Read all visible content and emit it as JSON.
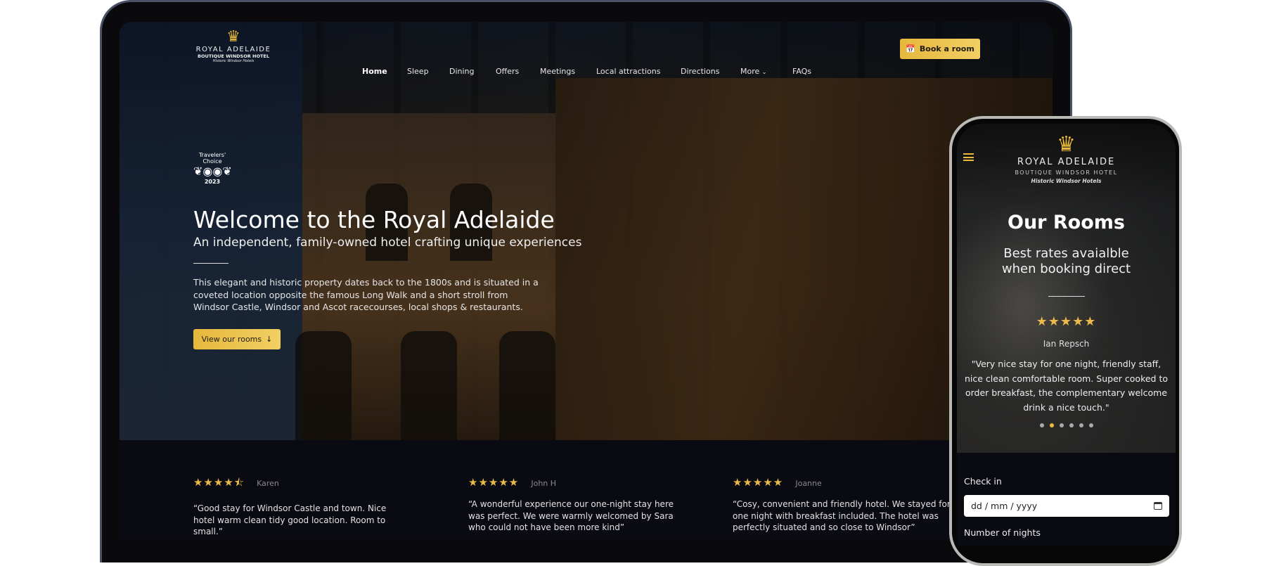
{
  "brand": {
    "name": "ROYAL ADELAIDE",
    "tagline": "BOUTIQUE WINDSOR HOTEL",
    "group": "Historic Windsor Hotels"
  },
  "nav": {
    "items": [
      "Home",
      "Sleep",
      "Dining",
      "Offers",
      "Meetings",
      "Local attractions",
      "Directions",
      "More",
      "FAQs"
    ],
    "book_label": "Book a room"
  },
  "badge": {
    "line1": "Travelers'",
    "line2": "Choice",
    "year": "2023"
  },
  "hero": {
    "title": "Welcome to the Royal Adelaide",
    "subtitle": "An independent, family-owned hotel crafting unique experiences",
    "body": "This elegant and historic property dates back to the 1800s and is situated in a coveted  location opposite the famous Long Walk and a short stroll from Windsor Castle, Windsor and Ascot racecourses, local shops & restaurants.",
    "cta": "View our rooms"
  },
  "reviews": [
    {
      "name": "Karen",
      "rating": 4.5,
      "stars": "★★★★⯪",
      "quote": "“Good stay for Windsor Castle and town. Nice hotel warm clean tidy good location. Room to small.”"
    },
    {
      "name": "John H",
      "rating": 5,
      "stars": "★★★★★",
      "quote": "“A wonderful experience our one-night stay here was perfect. We were warmly welcomed by Sara who could not have been more kind”"
    },
    {
      "name": "Joanne",
      "rating": 5,
      "stars": "★★★★★",
      "quote": "“Cosy, convenient and friendly hotel. We stayed for one night with breakfast included. The hotel was perfectly situated and so close to Windsor”"
    }
  ],
  "mobile": {
    "title": "Our Rooms",
    "subtitle": "Best rates avaialble when booking direct",
    "stars": "★★★★★",
    "reviewer": "Ian Repsch",
    "quote": "\"Very nice stay for one night, friendly staff, nice clean comfortable room. Super cooked to order breakfast, the complementary welcome drink a nice touch.\"",
    "slides": 6,
    "active_slide": 2,
    "checkin_label": "Check in",
    "checkin_placeholder": "dd / mm / yyyy",
    "nights_label": "Number of nights"
  },
  "colors": {
    "accent": "#e8b93a",
    "dark": "#0a0b12"
  }
}
